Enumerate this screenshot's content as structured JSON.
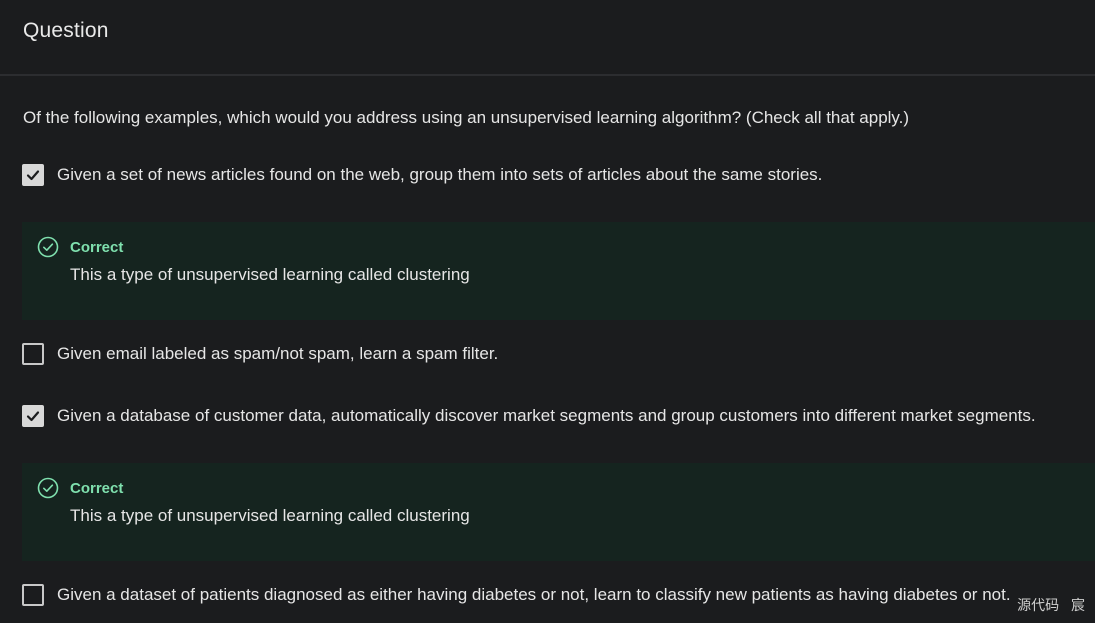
{
  "header": {
    "title": "Question"
  },
  "question": {
    "prompt": "Of the following examples, which would you address using an unsupervised learning algorithm?  (Check all that apply.)"
  },
  "options": [
    {
      "text": "Given a set of news articles found on the web, group them into sets of articles about the same stories.",
      "checked": true
    },
    {
      "text": "Given email labeled as spam/not spam, learn a spam filter.",
      "checked": false
    },
    {
      "text": "Given a database of customer data, automatically discover market segments and group customers into different market segments.",
      "checked": true
    },
    {
      "text": "Given a dataset of patients diagnosed as either having diabetes or not, learn to classify new patients as having diabetes or not.",
      "checked": false
    }
  ],
  "feedback": [
    {
      "label": "Correct",
      "text": "This a type of unsupervised learning called clustering"
    },
    {
      "label": "Correct",
      "text": "This a type of unsupervised learning called clustering"
    }
  ],
  "watermark": "源代码 宸",
  "colors": {
    "background": "#1b1c1e",
    "feedback_background": "#15241f",
    "correct_accent": "#7fe0ae",
    "checkbox_checked": "#d8d8d8"
  },
  "icons": {
    "checked": "check-icon",
    "correct": "check-circle-icon"
  }
}
